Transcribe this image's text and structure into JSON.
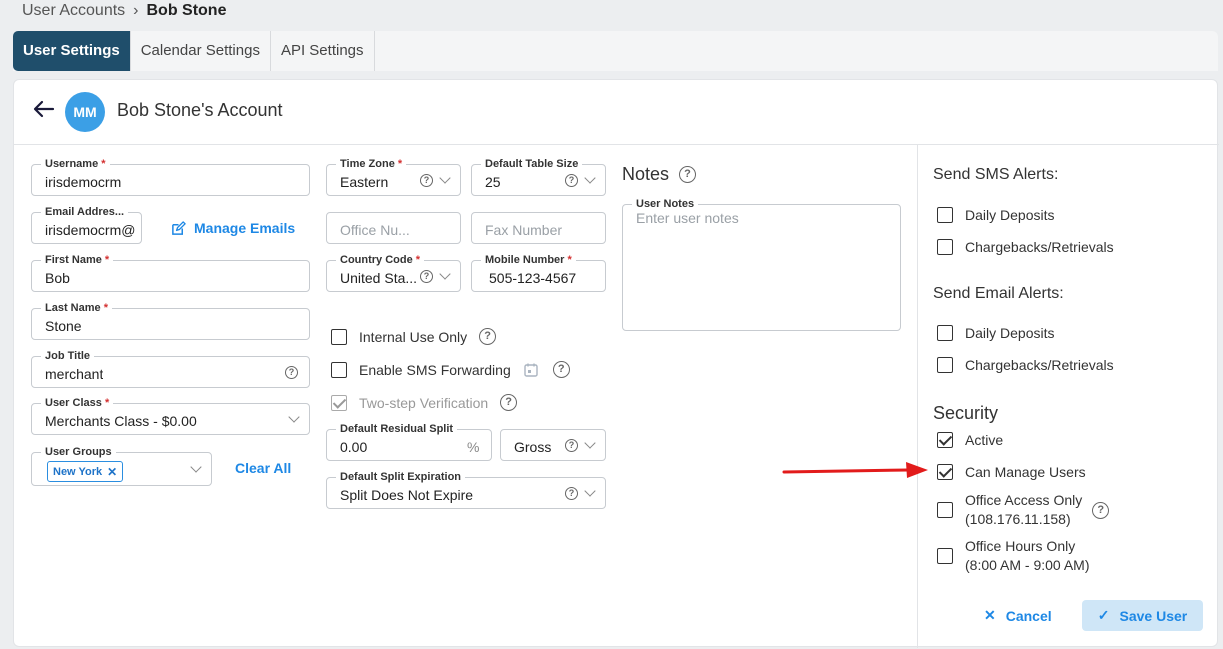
{
  "breadcrumb": {
    "parent": "User Accounts",
    "separator": "›",
    "current": "Bob Stone"
  },
  "tabs": [
    {
      "label": "User Settings",
      "active": true
    },
    {
      "label": "Calendar Settings",
      "active": false
    },
    {
      "label": "API Settings",
      "active": false
    }
  ],
  "header": {
    "avatar_initials": "MM",
    "title": "Bob Stone's Account"
  },
  "form": {
    "username": {
      "label": "Username",
      "value": "irisdemocrm"
    },
    "email": {
      "label": "Email Addres...",
      "value": "irisdemocrm@"
    },
    "manage_emails": "Manage Emails",
    "first_name": {
      "label": "First Name",
      "value": "Bob"
    },
    "last_name": {
      "label": "Last Name",
      "value": "Stone"
    },
    "job_title": {
      "label": "Job Title",
      "value": "merchant"
    },
    "user_class": {
      "label": "User Class",
      "value": "Merchants Class - $0.00"
    },
    "user_groups": {
      "label": "User Groups",
      "tag": "New York"
    },
    "clear_all": "Clear All",
    "time_zone": {
      "label": "Time Zone",
      "value": "Eastern"
    },
    "table_size": {
      "label": "Default Table Size",
      "value": "25"
    },
    "office_number": {
      "placeholder": "Office Nu..."
    },
    "fax_number": {
      "placeholder": "Fax Number"
    },
    "country_code": {
      "label": "Country Code",
      "value": "United Sta..."
    },
    "mobile_number": {
      "label": "Mobile Number",
      "value": "505-123-4567"
    },
    "internal_use_only": {
      "label": "Internal Use Only",
      "checked": false
    },
    "sms_forwarding": {
      "label": "Enable SMS Forwarding",
      "checked": false
    },
    "two_step": {
      "label": "Two-step Verification",
      "checked": true,
      "disabled": true
    },
    "residual_split": {
      "label": "Default Residual Split",
      "value": "0.00",
      "unit": "%"
    },
    "split_type": {
      "value": "Gross"
    },
    "split_expiration": {
      "label": "Default Split Expiration",
      "value": "Split Does Not Expire"
    }
  },
  "notes": {
    "heading": "Notes",
    "label": "User Notes",
    "placeholder": "Enter user notes"
  },
  "sms_alerts": {
    "heading": "Send SMS Alerts:",
    "items": [
      {
        "label": "Daily Deposits",
        "checked": false
      },
      {
        "label": "Chargebacks/Retrievals",
        "checked": false
      }
    ]
  },
  "email_alerts": {
    "heading": "Send Email Alerts:",
    "items": [
      {
        "label": "Daily Deposits",
        "checked": false
      },
      {
        "label": "Chargebacks/Retrievals",
        "checked": false
      }
    ]
  },
  "security": {
    "heading": "Security",
    "active": {
      "label": "Active",
      "checked": true
    },
    "manage_users": {
      "label": "Can Manage Users",
      "checked": true
    },
    "office_access": {
      "label_line1": "Office Access Only",
      "label_line2": "(108.176.11.158)",
      "checked": false
    },
    "office_hours": {
      "label_line1": "Office Hours Only",
      "label_line2": "(8:00 AM - 9:00 AM)",
      "checked": false
    }
  },
  "actions": {
    "cancel": "Cancel",
    "save": "Save User"
  },
  "colors": {
    "primary_tab": "#1f4e6b",
    "accent": "#1e88e5",
    "avatar": "#3b9fe6",
    "required": "#d32f2f",
    "arrow": "#e21b1b"
  }
}
